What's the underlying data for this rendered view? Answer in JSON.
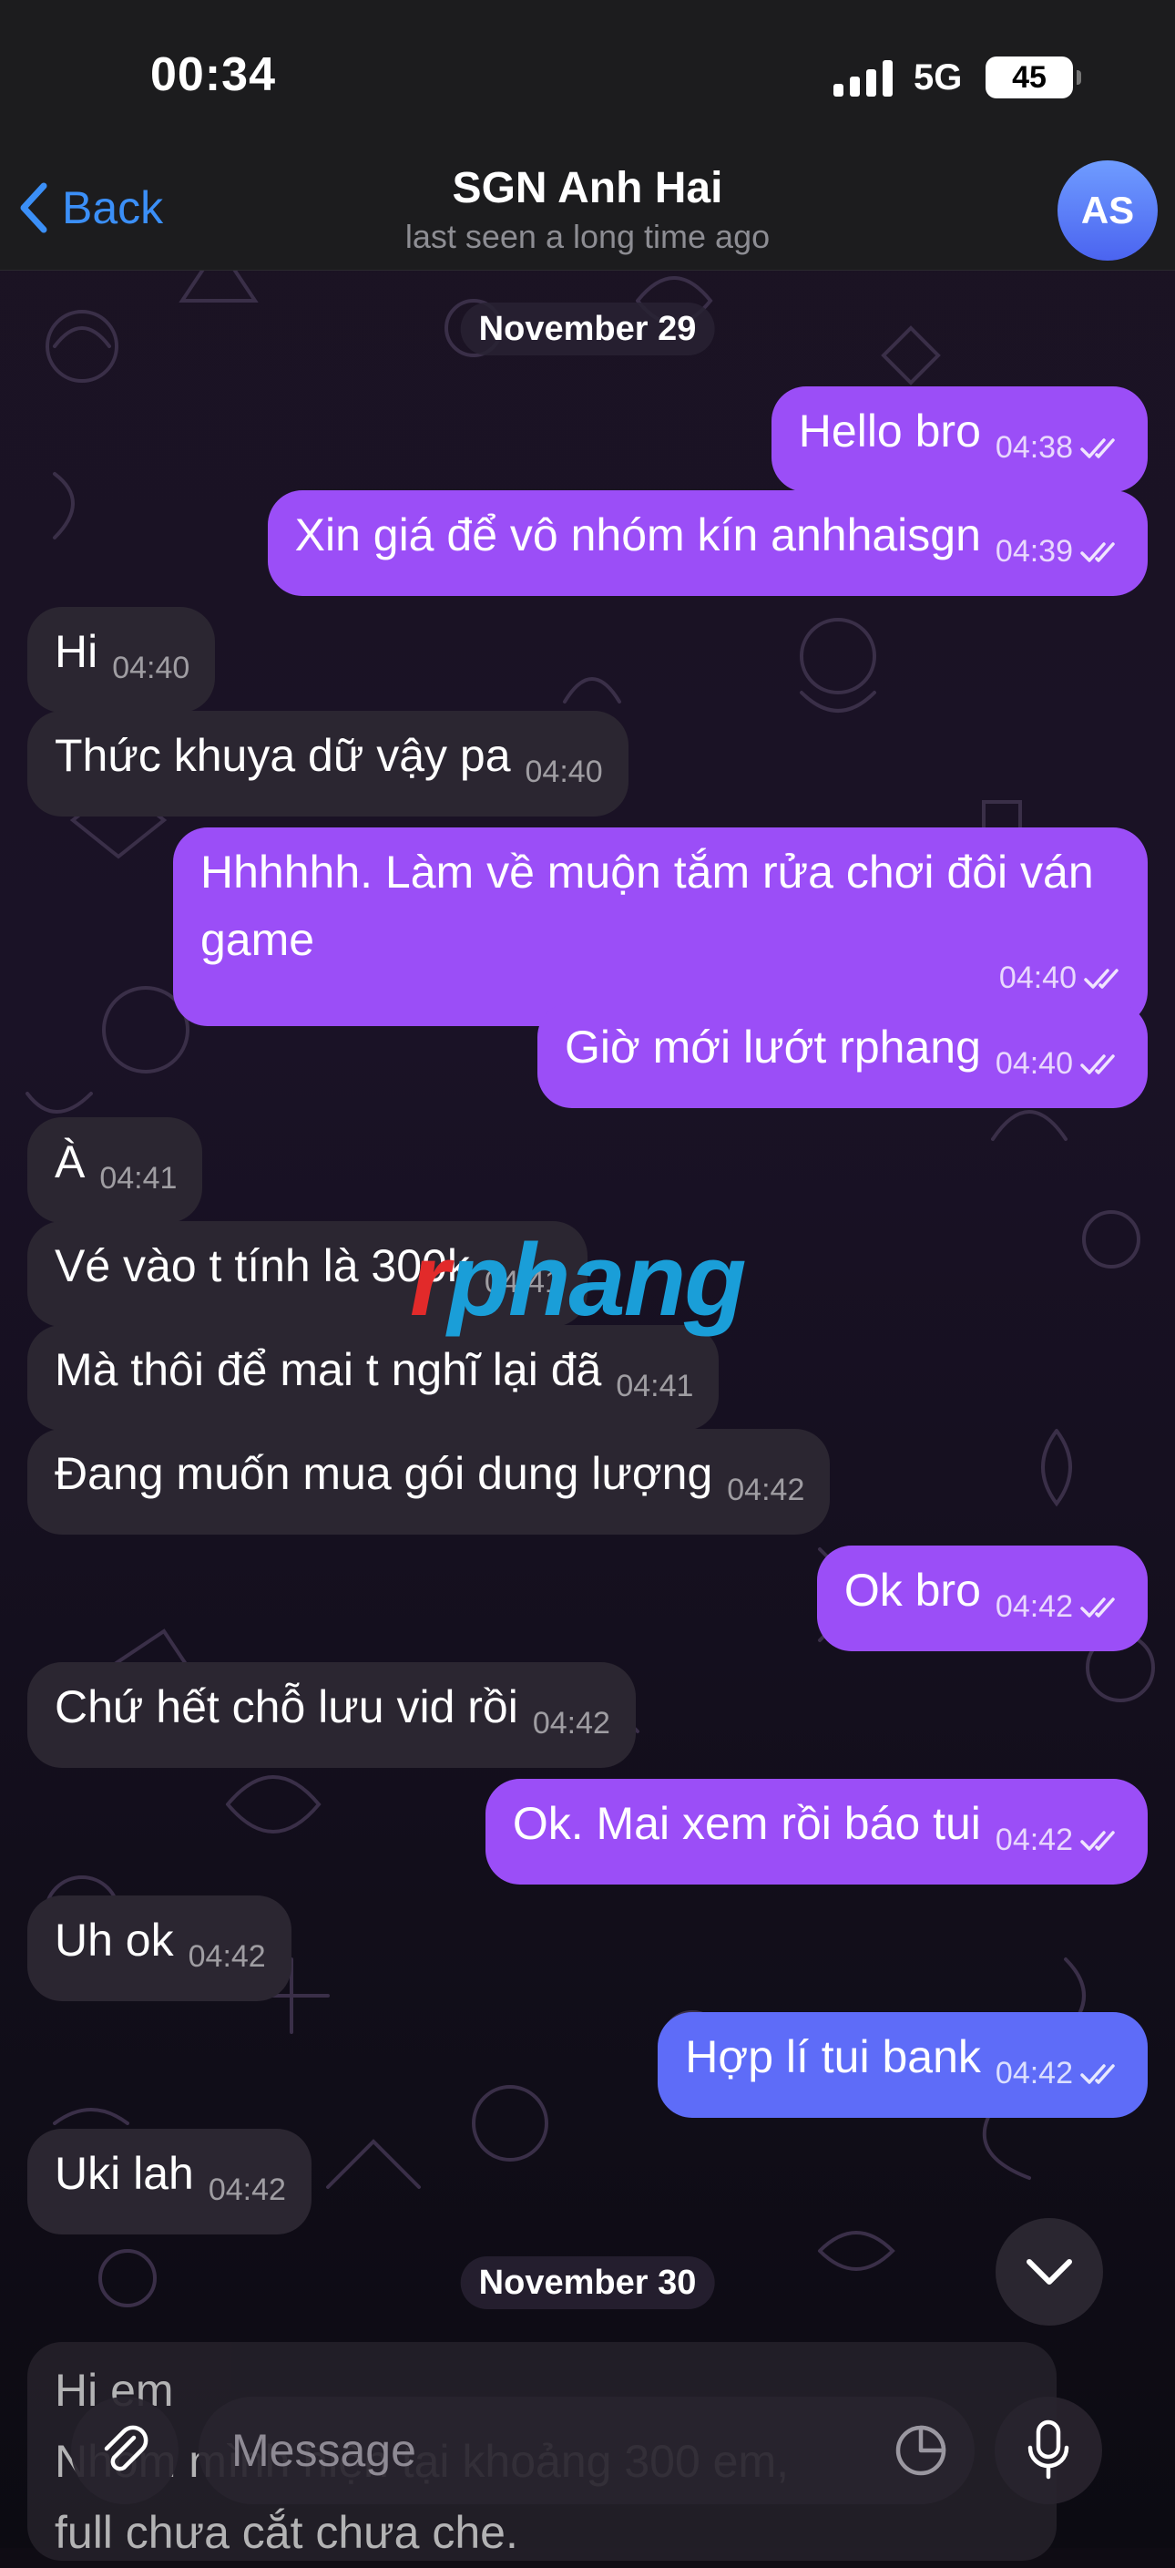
{
  "status_bar": {
    "time": "00:34",
    "network": "5G",
    "battery": "45"
  },
  "nav": {
    "back_label": "Back",
    "title": "SGN Anh Hai",
    "subtitle": "last seen a long time ago",
    "avatar_initials": "AS"
  },
  "colors": {
    "accent": "#3b8ff7",
    "outgoing_bubble": "#9b4ef7",
    "outgoing_bubble_blue": "#5e6cf8",
    "incoming_bubble": "#2b2631"
  },
  "dates": [
    "November 29",
    "November 30"
  ],
  "messages": [
    {
      "text": "Hello bro",
      "time": "04:38",
      "dir": "out",
      "read": true
    },
    {
      "text": "Xin giá để vô nhóm kín anhhaisgn",
      "time": "04:39",
      "dir": "out",
      "read": true
    },
    {
      "text": "Hi",
      "time": "04:40",
      "dir": "in"
    },
    {
      "text": "Thức khuya dữ vậy pa",
      "time": "04:40",
      "dir": "in"
    },
    {
      "text": "Hhhhhh. Làm về muộn tắm rửa chơi đôi ván game",
      "time": "04:40",
      "dir": "out",
      "read": true
    },
    {
      "text": "Giờ mới lướt rphang",
      "time": "04:40",
      "dir": "out",
      "read": true
    },
    {
      "text": "À",
      "time": "04:41",
      "dir": "in"
    },
    {
      "text": "Vé vào t tính là 300k",
      "time": "04:41",
      "dir": "in"
    },
    {
      "text": "Mà thôi để mai t nghĩ lại đã",
      "time": "04:41",
      "dir": "in"
    },
    {
      "text": "Đang muốn mua gói dung lượng",
      "time": "04:42",
      "dir": "in"
    },
    {
      "text": "Ok bro",
      "time": "04:42",
      "dir": "out",
      "read": true
    },
    {
      "text": "Chứ hết chỗ lưu vid rồi",
      "time": "04:42",
      "dir": "in"
    },
    {
      "text": "Ok. Mai xem rồi báo tui",
      "time": "04:42",
      "dir": "out",
      "read": true
    },
    {
      "text": "Uh ok",
      "time": "04:42",
      "dir": "in"
    },
    {
      "text": "Hợp lí tui bank",
      "time": "04:42",
      "dir": "out",
      "read": true
    },
    {
      "text": "Uki lah",
      "time": "04:42",
      "dir": "in"
    }
  ],
  "partial_message": {
    "line1": "Hi em",
    "line2": "Nhóm mình hiện tại khoảng 300 em,",
    "line3": "full chưa cắt chưa che."
  },
  "watermark": {
    "first": "r",
    "rest": "phang"
  },
  "input": {
    "placeholder": "Message"
  },
  "icons": {
    "back": "chevron-left-icon",
    "attach": "paperclip-icon",
    "sticker": "sticker-icon",
    "mic": "microphone-icon",
    "scroll_down": "chevron-down-icon",
    "read": "double-check-icon"
  }
}
